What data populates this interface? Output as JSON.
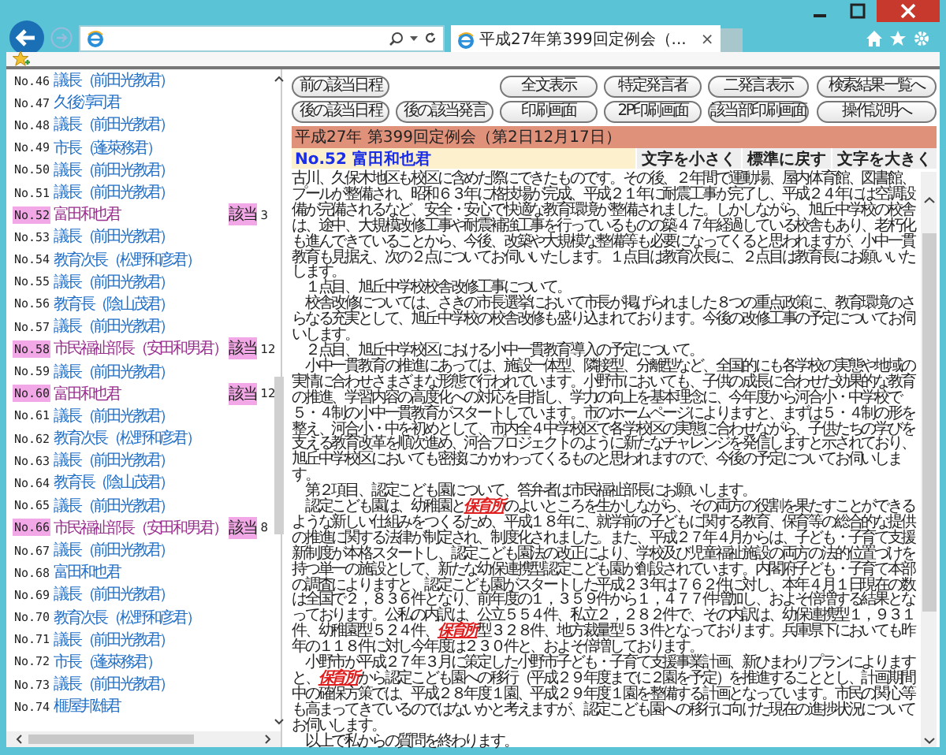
{
  "browser": {
    "tab_title": "平成27年第399回定例会（...",
    "tab_close": "×"
  },
  "speaker_list": {
    "items": [
      {
        "number": "No.46",
        "name": "議長（前田光教君）",
        "highlighted": false
      },
      {
        "number": "No.47",
        "name": "久後淳司君",
        "highlighted": false
      },
      {
        "number": "No.48",
        "name": "議長（前田光教君）",
        "highlighted": false
      },
      {
        "number": "No.49",
        "name": "市長（蓬萊務君）",
        "highlighted": false
      },
      {
        "number": "No.50",
        "name": "議長（前田光教君）",
        "highlighted": false
      },
      {
        "number": "No.51",
        "name": "議長（前田光教君）",
        "highlighted": false
      },
      {
        "number": "No.52",
        "name": "富田和也君",
        "highlighted": true,
        "badge": "該当",
        "count": "3"
      },
      {
        "number": "No.53",
        "name": "議長（前田光教君）",
        "highlighted": false
      },
      {
        "number": "No.54",
        "name": "教育次長（松野和彦君）",
        "highlighted": false
      },
      {
        "number": "No.55",
        "name": "議長（前田光教君）",
        "highlighted": false
      },
      {
        "number": "No.56",
        "name": "教育長（陰山茂君）",
        "highlighted": false
      },
      {
        "number": "No.57",
        "name": "議長（前田光教君）",
        "highlighted": false
      },
      {
        "number": "No.58",
        "name": "市民福祉部長（安田和男君）",
        "highlighted": true,
        "badge": "該当",
        "count": "12"
      },
      {
        "number": "No.59",
        "name": "議長（前田光教君）",
        "highlighted": false
      },
      {
        "number": "No.60",
        "name": "富田和也君",
        "highlighted": true,
        "badge": "該当",
        "count": "12"
      },
      {
        "number": "No.61",
        "name": "議長（前田光教君）",
        "highlighted": false
      },
      {
        "number": "No.62",
        "name": "教育次長（松野和彦君）",
        "highlighted": false
      },
      {
        "number": "No.63",
        "name": "議長（前田光教君）",
        "highlighted": false
      },
      {
        "number": "No.64",
        "name": "教育長（陰山茂君）",
        "highlighted": false
      },
      {
        "number": "No.65",
        "name": "議長（前田光教君）",
        "highlighted": false
      },
      {
        "number": "No.66",
        "name": "市民福祉部長（安田和男君）",
        "highlighted": true,
        "badge": "該当",
        "count": "8"
      },
      {
        "number": "No.67",
        "name": "議長（前田光教君）",
        "highlighted": false
      },
      {
        "number": "No.68",
        "name": "富田和也君",
        "highlighted": false
      },
      {
        "number": "No.69",
        "name": "議長（前田光教君）",
        "highlighted": false
      },
      {
        "number": "No.70",
        "name": "教育次長（松野和彦君）",
        "highlighted": false
      },
      {
        "number": "No.71",
        "name": "議長（前田光教君）",
        "highlighted": false
      },
      {
        "number": "No.72",
        "name": "市長（蓬萊務君）",
        "highlighted": false
      },
      {
        "number": "No.73",
        "name": "議長（前田光教君）",
        "highlighted": false
      },
      {
        "number": "No.74",
        "name": "榧屋邦雄君",
        "highlighted": false
      }
    ]
  },
  "button_rows": [
    {
      "left": [
        "前の該当日程"
      ],
      "middle": [
        "全文表示",
        "特定発言者",
        "二発言表示"
      ],
      "right": [
        "検索結果一覧へ"
      ]
    },
    {
      "left": [
        "後の該当日程",
        "後の該当発言"
      ],
      "middle": [
        "印刷画面",
        "2P印刷画面",
        "該当部印刷画面"
      ],
      "right": [
        "操作説明へ"
      ]
    }
  ],
  "meeting_title": "平成27年 第399回定例会（第2日12月17日）",
  "speaker": "No.52 富田和也君",
  "font_buttons": [
    "文字を小さく",
    "標準に戻す",
    "文字を大きく"
  ],
  "paragraphs": [
    {
      "segments": [
        {
          "text": "古川、久保木地区も校区に含めた際にできたものです。その後、２年間で運動場、屋内体育館、図書館、プールが整備され、昭和６３年に格技場が完成、平成２１年に耐震工事が完了し、平成２４年には空調設備が完備されるなど、安全・安心で快適な教育環境が整備されました。しかしながら、旭丘中学校の校舎は、途中、大規模改修工事や耐震補強工事を行っているものの築４７年経過している校舎もあり、老朽化も進んできていることから、今後、改築や大規模な整備等も必要になってくると思われますが、小中一貫教育も見据え、次の２点についてお伺いいたします。１点目は教育次長に、２点目は教育長にお願いいたします。",
          "hit": false
        }
      ]
    },
    {
      "segments": [
        {
          "text": "　１点目、旭丘中学校校舎改修工事について。",
          "hit": false
        }
      ]
    },
    {
      "segments": [
        {
          "text": "　校舎改修については、さきの市長選挙において市長が掲げられました８つの重点政策に、教育環境のさらなる充実として、旭丘中学校の校舎改修も盛り込まれております。今後の改修工事の予定についてお伺いします。",
          "hit": false
        }
      ]
    },
    {
      "segments": [
        {
          "text": "　２点目、旭丘中学校区における小中一貫教育導入の予定について。",
          "hit": false
        }
      ]
    },
    {
      "segments": [
        {
          "text": "　小中一貫教育の推進にあっては、施設一体型、隣接型、分離型など、全国的にも各学校の実態や地域の実情に合わせさまざまな形態で行われています。小野市においても、子供の成長に合わせた効果的な教育の推進、学習内容の高度化への対応を目指し、学力の向上を基本理念に、今年度から河合小・中学校で５・４制の小中一貫教育がスタートしています。市のホームページによりますと、まずは５・４制の形を整え、河合小・中を初めとして、市内全４中学校区で各学校区の実態に合わせながら、子供たちの学びを支える教育改革を順次進め、河合プロジェクトのように新たなチャレンジを発信しますと示されており、旭丘中学校区においても密接にかかわってくるものと思われますので、今後の予定についてお伺いします。",
          "hit": false
        }
      ]
    },
    {
      "segments": [
        {
          "text": "　第２項目、認定こども園について、答弁者は市民福祉部長にお願いします。",
          "hit": false
        }
      ]
    },
    {
      "segments": [
        {
          "text": "　認定こども園は、幼稚園と",
          "hit": false
        },
        {
          "text": "保育所",
          "hit": true
        },
        {
          "text": "のよいところを生かしながら、その両方の役割を果たすことができるような新しい仕組みをつくるため、平成１８年に、就学前の子どもに関する教育、保育等の総合的な提供の推進に関する法律が制定され、制度化されました。また、平成２７年４月からは、子ども・子育て支援新制度が本格スタートし、認定こども園法の改正により、学校及び児童福祉施設の両方の法的位置づけを持つ単一の施設として、新たな幼保連携型認定こども園が創設されています。内閣府子ども・子育て本部の調査によりますと、認定こども園がスタートした平成２３年は７６２件に対し、本年４月１日現在の数は全国で２，８３６件となり、前年度の１，３５９件から１，４７７件増加し、およそ倍増する結果となっております。公私の内訳は、公立５５４件、私立２，２８２件で、その内訳は、幼保連携型１，９３１件、幼稚園型５２４件、",
          "hit": false
        },
        {
          "text": "保育所",
          "hit": true
        },
        {
          "text": "型３２８件、地方裁量型５３件となっております。兵庫県下においても昨年の１１８件に対し今年度は２３０件と、およそ倍増しております。",
          "hit": false
        }
      ]
    },
    {
      "segments": [
        {
          "text": "　小野市が平成２７年３月に策定した小野市子ども・子育て支援事業計画、新ひまわりプランによりますと、",
          "hit": false
        },
        {
          "text": "保育所",
          "hit": true
        },
        {
          "text": "から認定こども園への移行（平成２９年度までに２園を予定）を推進することとし、計画期間中の確保方策では、平成２８年度１園、平成２９年度１園を整備する計画となっています。市民の関心等も高まってきているのではないかと考えますが、認定こども園への移行に向けた現在の進捗状況についてお伺いします。",
          "hit": false
        }
      ]
    },
    {
      "segments": [
        {
          "text": "　以上で私からの質問を終わります。",
          "hit": false
        }
      ]
    }
  ]
}
